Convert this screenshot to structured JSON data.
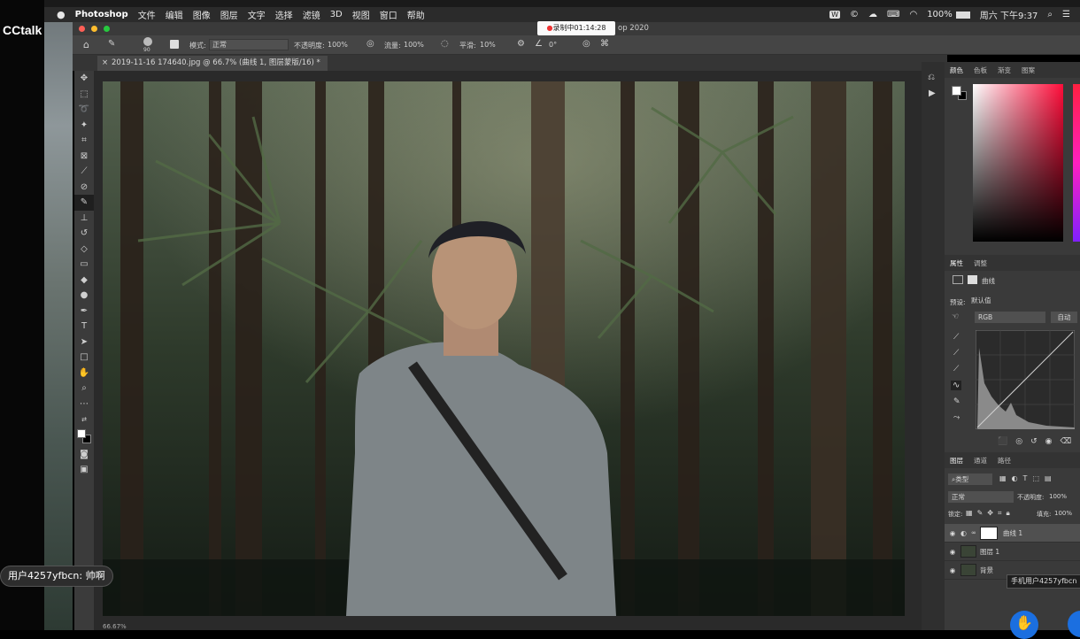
{
  "overlay": {
    "brand": "CCtalk",
    "recording": "录制中01:14:28",
    "chat_message": "用户4257yfbcn: 帅啊",
    "tooltip": "手机用户4257yfbcn"
  },
  "menubar": {
    "app": "Photoshop",
    "items": [
      "文件",
      "编辑",
      "图像",
      "图层",
      "文字",
      "选择",
      "滤镜",
      "3D",
      "视图",
      "窗口",
      "帮助"
    ],
    "title_suffix": "op 2020",
    "battery": "100%",
    "clock": "周六 下午9:37"
  },
  "options": {
    "brush_size": "90",
    "mode_label": "模式:",
    "mode_value": "正常",
    "opacity_label": "不透明度:",
    "opacity_value": "100%",
    "flow_label": "流量:",
    "flow_value": "100%",
    "smooth_label": "平滑:",
    "smooth_value": "10%",
    "angle_value": "0°"
  },
  "document": {
    "tab": "2019-11-16 174640.jpg @ 66.7% (曲线 1, 图层蒙版/16) *"
  },
  "color_panel": {
    "tabs": [
      "颜色",
      "色板",
      "渐变",
      "图案"
    ]
  },
  "properties": {
    "tabs": [
      "属性",
      "调整"
    ],
    "title": "曲线",
    "preset_label": "预设:",
    "preset_value": "默认值",
    "channel": "RGB",
    "auto": "自动"
  },
  "layers": {
    "tabs": [
      "图层",
      "通道",
      "路径"
    ],
    "filter": "类型",
    "blend": "正常",
    "opacity_label": "不透明度:",
    "opacity_value": "100%",
    "lock_label": "锁定:",
    "fill_label": "填充:",
    "fill_value": "100%",
    "items": [
      "曲线 1",
      "图层 1",
      "背景"
    ]
  },
  "status": {
    "zoom": "66.67%"
  }
}
